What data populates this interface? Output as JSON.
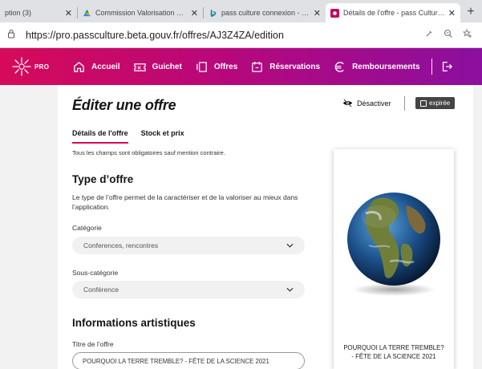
{
  "browser": {
    "tabs": [
      {
        "title": "ption (3)",
        "active": false
      },
      {
        "title": "Commission Valorisation du Pas",
        "active": false
      },
      {
        "title": "pass culture connexion - Bing",
        "active": false
      },
      {
        "title": "Détails de l'offre - pass Culture P",
        "active": true
      }
    ],
    "new_tab": "+",
    "url": "https://pro.passculture.beta.gouv.fr/offres/AJ3Z4ZA/edition"
  },
  "header": {
    "logo_text": "PRO",
    "nav": [
      {
        "label": "Accueil",
        "icon": "home-icon"
      },
      {
        "label": "Guichet",
        "icon": "ticket-icon"
      },
      {
        "label": "Offres",
        "icon": "offers-icon"
      },
      {
        "label": "Réservations",
        "icon": "calendar-icon"
      },
      {
        "label": "Remboursements",
        "icon": "euro-icon"
      }
    ],
    "logout_icon": "logout-icon",
    "gradient": [
      "#d60a59",
      "#8b0f9f"
    ]
  },
  "page": {
    "title": "Éditer une offre",
    "deactivate_label": "Désactiver",
    "expired_badge": "expirée",
    "tabs": [
      "Détails de l'offre",
      "Stock et prix"
    ],
    "required_note": "Tous les champs sont obligatoires sauf mention contraire.",
    "offer_type_heading": "Type d’offre",
    "offer_type_desc": "Le type de l’offre permet de la caractériser et de la valoriser au mieux dans l’application.",
    "category_label": "Catégorie",
    "category_value": "Conferences, rencontres",
    "subcategory_label": "Sous-catégorie",
    "subcategory_value": "Conférence",
    "artistic_heading": "Informations artistiques",
    "title_label": "Titre de l’offre",
    "title_value": "POURQUOI LA TERRE TREMBLE? - FÊTE DE LA SCIENCE 2021"
  },
  "preview": {
    "title": "POURQUOI LA TERRE TREMBLE? - FÊTE DE LA SCIENCE 2021",
    "image": "earth-globe-image"
  },
  "colors": {
    "accent": "#d60a59",
    "badge": "#444444"
  }
}
